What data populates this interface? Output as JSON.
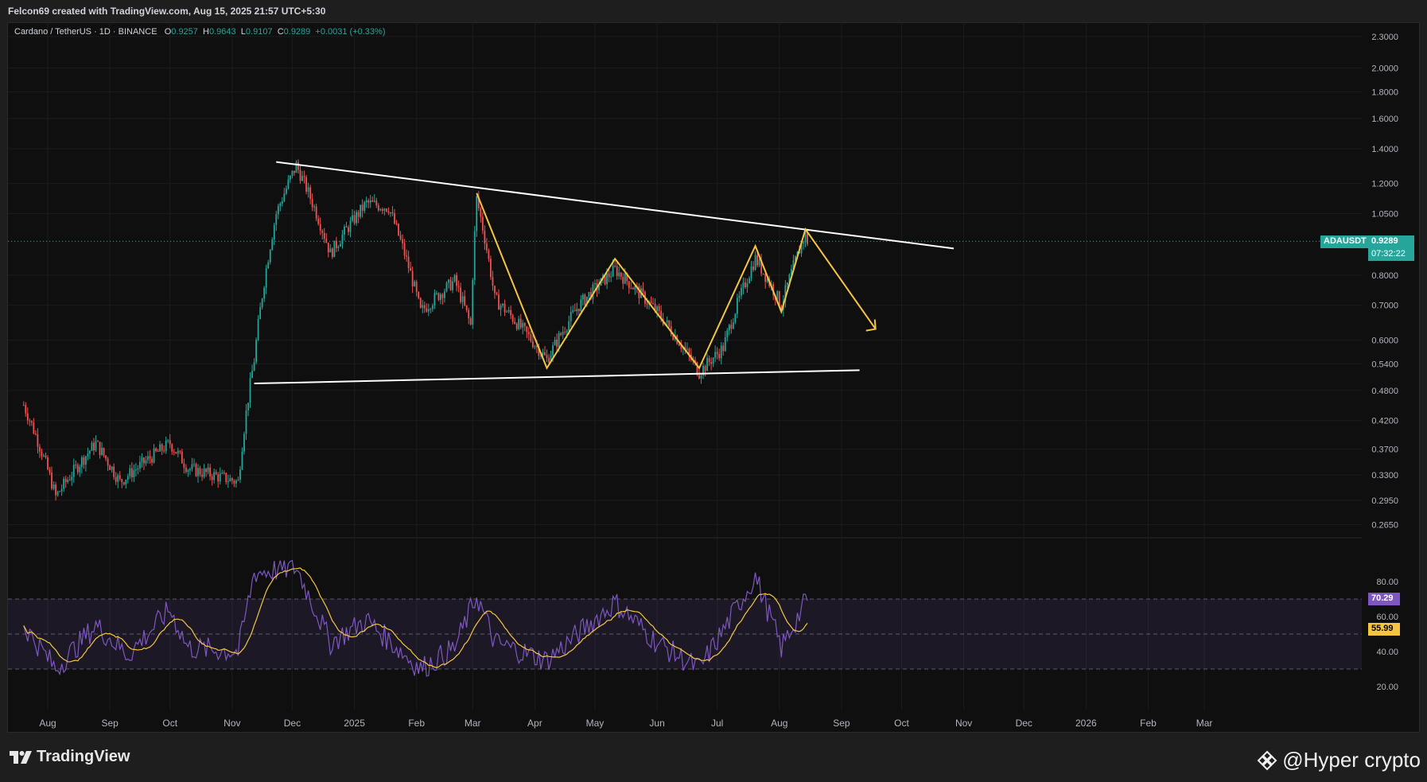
{
  "header": {
    "credit": "Felcon69 created with TradingView.com, Aug 15, 2025 21:57 UTC+5:30"
  },
  "legend": {
    "symbol": "Cardano / TetherUS · 1D · BINANCE",
    "o_label": "O",
    "o_value": "0.9257",
    "h_label": "H",
    "h_value": "0.9643",
    "l_label": "L",
    "l_value": "0.9107",
    "c_label": "C",
    "c_value": "0.9289",
    "change": "+0.0031 (+0.33%)"
  },
  "price_tag": {
    "ticker": "ADAUSDT",
    "price": "0.9289",
    "countdown": "07:32:22"
  },
  "rsi_tags": {
    "rsi": "70.29",
    "ma": "55.99"
  },
  "footer": {
    "brand": "TradingView",
    "watermark": "@Hyper crypto"
  },
  "colors": {
    "up": "#26a69a",
    "down": "#ef5350",
    "pattern": "#f5c542",
    "trendline": "#ffffff",
    "rsi": "#7e57c2",
    "rsi_ma": "#f5c542"
  },
  "chart_data": [
    {
      "type": "candlestick",
      "title": "Cardano / TetherUS · 1D · BINANCE",
      "y_scale": "log",
      "y_ticks": [
        "2.3000",
        "2.0000",
        "1.8000",
        "1.6000",
        "1.4000",
        "1.2000",
        "1.0500",
        "0.8000",
        "0.7000",
        "0.6000",
        "0.5400",
        "0.4800",
        "0.4200",
        "0.3700",
        "0.3300",
        "0.2950",
        "0.2650"
      ],
      "x_ticks": [
        "Aug",
        "Sep",
        "Oct",
        "Nov",
        "Dec",
        "2025",
        "Feb",
        "Mar",
        "Apr",
        "May",
        "Jun",
        "Jul",
        "Aug",
        "Sep",
        "Oct",
        "Nov",
        "Dec",
        "2026",
        "Feb",
        "Mar"
      ],
      "last_close": 0.9289,
      "approx_close_path": [
        {
          "date": "2024-07-20",
          "close": 0.45
        },
        {
          "date": "2024-08-05",
          "close": 0.3
        },
        {
          "date": "2024-08-25",
          "close": 0.38
        },
        {
          "date": "2024-09-06",
          "close": 0.32
        },
        {
          "date": "2024-10-01",
          "close": 0.38
        },
        {
          "date": "2024-10-10",
          "close": 0.34
        },
        {
          "date": "2024-11-04",
          "close": 0.32
        },
        {
          "date": "2024-11-12",
          "close": 0.55
        },
        {
          "date": "2024-11-23",
          "close": 1.05
        },
        {
          "date": "2024-12-03",
          "close": 1.3
        },
        {
          "date": "2024-12-20",
          "close": 0.88
        },
        {
          "date": "2025-01-07",
          "close": 1.1
        },
        {
          "date": "2025-01-18",
          "close": 1.08
        },
        {
          "date": "2025-02-03",
          "close": 0.68
        },
        {
          "date": "2025-02-20",
          "close": 0.78
        },
        {
          "date": "2025-02-28",
          "close": 0.64
        },
        {
          "date": "2025-03-03",
          "close": 1.12
        },
        {
          "date": "2025-03-12",
          "close": 0.72
        },
        {
          "date": "2025-04-07",
          "close": 0.55
        },
        {
          "date": "2025-04-23",
          "close": 0.7
        },
        {
          "date": "2025-05-11",
          "close": 0.82
        },
        {
          "date": "2025-06-01",
          "close": 0.68
        },
        {
          "date": "2025-06-22",
          "close": 0.52
        },
        {
          "date": "2025-07-04",
          "close": 0.58
        },
        {
          "date": "2025-07-20",
          "close": 0.86
        },
        {
          "date": "2025-08-02",
          "close": 0.7
        },
        {
          "date": "2025-08-14",
          "close": 0.96
        },
        {
          "date": "2025-08-15",
          "close": 0.9289
        }
      ],
      "drawings": {
        "upper_trendline": [
          {
            "date": "2024-11-23",
            "price": 1.32
          },
          {
            "date": "2025-10-27",
            "price": 0.9
          }
        ],
        "lower_trendline": [
          {
            "date": "2024-11-12",
            "price": 0.495
          },
          {
            "date": "2025-09-10",
            "price": 0.525
          }
        ],
        "zigzag": [
          {
            "date": "2025-03-03",
            "price": 1.15
          },
          {
            "date": "2025-04-07",
            "price": 0.53
          },
          {
            "date": "2025-05-11",
            "price": 0.86
          },
          {
            "date": "2025-06-22",
            "price": 0.53
          },
          {
            "date": "2025-07-20",
            "price": 0.91
          },
          {
            "date": "2025-08-02",
            "price": 0.68
          },
          {
            "date": "2025-08-14",
            "price": 0.98
          },
          {
            "date": "2025-09-18",
            "price": 0.63
          }
        ]
      }
    },
    {
      "type": "line",
      "title": "RSI",
      "y_ticks": [
        "80.00",
        "60.00",
        "40.00",
        "20.00"
      ],
      "levels": [
        70,
        50,
        30
      ],
      "series": [
        {
          "name": "RSI",
          "last": 70.29
        },
        {
          "name": "RSI MA",
          "last": 55.99
        }
      ],
      "approx_rsi_path": [
        {
          "date": "2024-07-20",
          "rsi": 55
        },
        {
          "date": "2024-08-05",
          "rsi": 30
        },
        {
          "date": "2024-08-25",
          "rsi": 55
        },
        {
          "date": "2024-09-10",
          "rsi": 38
        },
        {
          "date": "2024-10-01",
          "rsi": 64
        },
        {
          "date": "2024-10-10",
          "rsi": 42
        },
        {
          "date": "2024-11-04",
          "rsi": 40
        },
        {
          "date": "2024-11-12",
          "rsi": 85
        },
        {
          "date": "2024-12-03",
          "rsi": 88
        },
        {
          "date": "2024-12-20",
          "rsi": 45
        },
        {
          "date": "2025-01-07",
          "rsi": 58
        },
        {
          "date": "2025-02-03",
          "rsi": 30
        },
        {
          "date": "2025-02-20",
          "rsi": 42
        },
        {
          "date": "2025-03-03",
          "rsi": 72
        },
        {
          "date": "2025-03-12",
          "rsi": 45
        },
        {
          "date": "2025-04-07",
          "rsi": 35
        },
        {
          "date": "2025-05-11",
          "rsi": 68
        },
        {
          "date": "2025-06-01",
          "rsi": 45
        },
        {
          "date": "2025-06-22",
          "rsi": 30
        },
        {
          "date": "2025-07-04",
          "rsi": 52
        },
        {
          "date": "2025-07-20",
          "rsi": 83
        },
        {
          "date": "2025-08-02",
          "rsi": 42
        },
        {
          "date": "2025-08-15",
          "rsi": 70.29
        }
      ]
    }
  ]
}
